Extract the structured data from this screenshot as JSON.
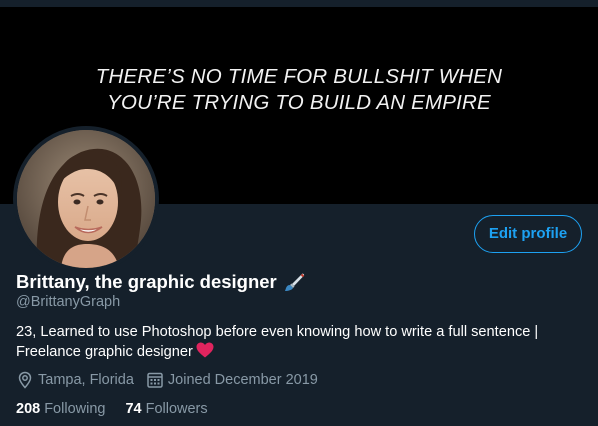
{
  "banner": {
    "line1": "THERE’S NO TIME FOR BULLSHIT WHEN",
    "line2": "YOU’RE TRYING TO BUILD AN EMPIRE"
  },
  "profile": {
    "display_name": "Brittany, the graphic designer",
    "name_emoji_icon": "paintbrush-icon",
    "handle": "@BrittanyGraph",
    "bio_line1": "23, Learned to use Photoshop before even knowing how to write a full sentence |",
    "bio_line2": "Freelance graphic designer",
    "bio_emoji_icon": "red-heart-icon",
    "location": "Tampa, Florida",
    "location_icon": "location-pin-icon",
    "joined": "Joined December 2019",
    "joined_icon": "calendar-icon"
  },
  "actions": {
    "edit_profile_label": "Edit profile"
  },
  "stats": {
    "following_count": "208",
    "following_label": "Following",
    "followers_count": "74",
    "followers_label": "Followers"
  },
  "colors": {
    "background": "#15202b",
    "accent": "#1da1f2",
    "secondary_text": "#8899a6",
    "banner_bg": "#000000",
    "heart": "#e0245e"
  }
}
